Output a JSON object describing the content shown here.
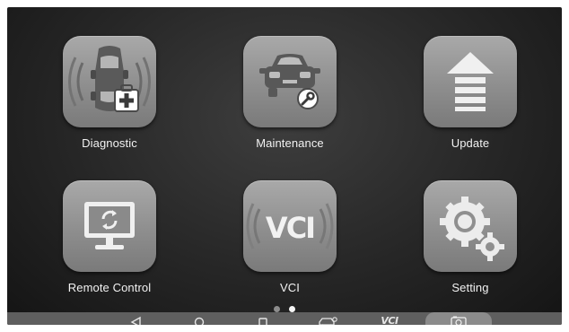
{
  "apps": [
    {
      "label": "Diagnostic",
      "icon": "car-diagnostic-icon"
    },
    {
      "label": "Maintenance",
      "icon": "car-wrench-icon"
    },
    {
      "label": "Update",
      "icon": "update-arrow-icon"
    },
    {
      "label": "Remote Control",
      "icon": "remote-monitor-icon"
    },
    {
      "label": "VCI",
      "icon": "vci-icon",
      "icon_text": "VCI"
    },
    {
      "label": "Setting",
      "icon": "gears-icon"
    }
  ],
  "pagination": {
    "pages": 2,
    "current": 2
  },
  "nav_bar": {
    "items": [
      "back-icon",
      "home-icon",
      "recent-apps-icon",
      "car-shortcut-icon",
      "vci-shortcut-icon",
      "screenshot-icon"
    ],
    "vci_text": "VCI"
  },
  "colors": {
    "background": "#262626",
    "tile": "#9a9a9a",
    "nav_bar": "#5f5f5f",
    "label": "#f2f2f2"
  }
}
